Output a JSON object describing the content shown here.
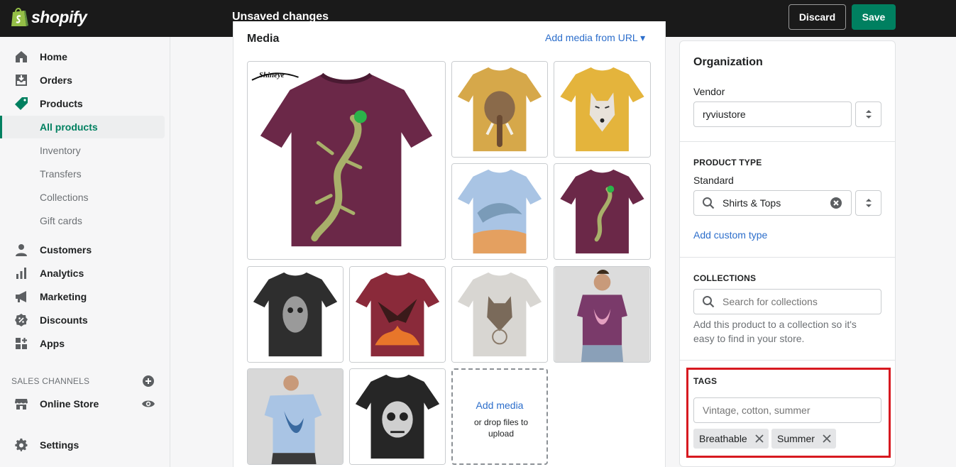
{
  "topbar": {
    "brand": "shopify",
    "status": "Unsaved changes",
    "discard_label": "Discard",
    "save_label": "Save"
  },
  "sidebar": {
    "items": [
      {
        "label": "Home",
        "icon": "home-icon"
      },
      {
        "label": "Orders",
        "icon": "orders-icon"
      },
      {
        "label": "Products",
        "icon": "tag-icon"
      },
      {
        "label": "All products",
        "active": true
      },
      {
        "label": "Inventory"
      },
      {
        "label": "Transfers"
      },
      {
        "label": "Collections"
      },
      {
        "label": "Gift cards"
      },
      {
        "label": "Customers",
        "icon": "person-icon"
      },
      {
        "label": "Analytics",
        "icon": "bar-chart-icon"
      },
      {
        "label": "Marketing",
        "icon": "megaphone-icon"
      },
      {
        "label": "Discounts",
        "icon": "discount-icon"
      },
      {
        "label": "Apps",
        "icon": "apps-icon"
      }
    ],
    "sales_channels_label": "SALES CHANNELS",
    "online_store_label": "Online Store",
    "settings_label": "Settings"
  },
  "media": {
    "title": "Media",
    "add_from_url": "Add media from URL ▾",
    "logo_text": "Shineye",
    "dropzone_add": "Add media",
    "dropzone_hint": "or drop files to upload"
  },
  "organization": {
    "title": "Organization",
    "vendor_label": "Vendor",
    "vendor_value": "ryviustore",
    "product_type_caption": "PRODUCT TYPE",
    "product_type_standard": "Standard",
    "product_type_value": "Shirts & Tops",
    "add_custom_type": "Add custom type",
    "collections_caption": "COLLECTIONS",
    "collections_placeholder": "Search for collections",
    "collections_help": "Add this product to a collection so it's easy to find in your store.",
    "tags_caption": "TAGS",
    "tags_placeholder": "Vintage, cotton, summer",
    "tags": [
      "Breathable",
      "Summer"
    ]
  },
  "colors": {
    "accent": "#008060",
    "link": "#2c6ecb",
    "highlight": "#d71920",
    "topbar": "#1a1a1a"
  }
}
